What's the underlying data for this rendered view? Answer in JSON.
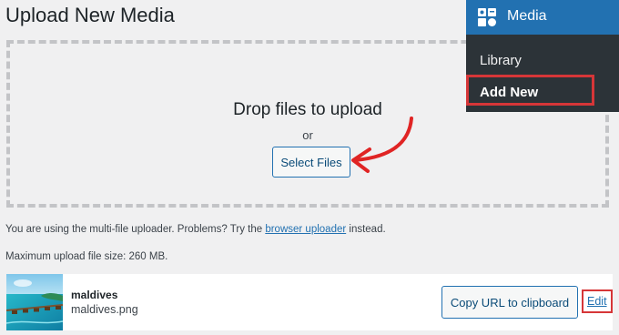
{
  "page": {
    "title": "Upload New Media"
  },
  "uploader": {
    "drop_text": "Drop files to upload",
    "or_text": "or",
    "select_button": "Select Files",
    "multi_info_before": "You are using the multi-file uploader. Problems? Try the",
    "browser_uploader_link": "browser uploader",
    "multi_info_after": "instead.",
    "max_size": "Maximum upload file size: 260 MB."
  },
  "upload_item": {
    "title": "maldives",
    "filename": "maldives.png",
    "copy_button": "Copy URL to clipboard",
    "edit_link": "Edit"
  },
  "admin_menu": {
    "header": "Media",
    "items": [
      {
        "label": "Library"
      },
      {
        "label": "Add New"
      }
    ]
  },
  "colors": {
    "accent": "#2271b1",
    "highlight": "#d63638",
    "menu_bg": "#2c3338",
    "page_bg": "#f0f0f1"
  },
  "icons": [
    "media-icon",
    "arrow-annotation"
  ]
}
